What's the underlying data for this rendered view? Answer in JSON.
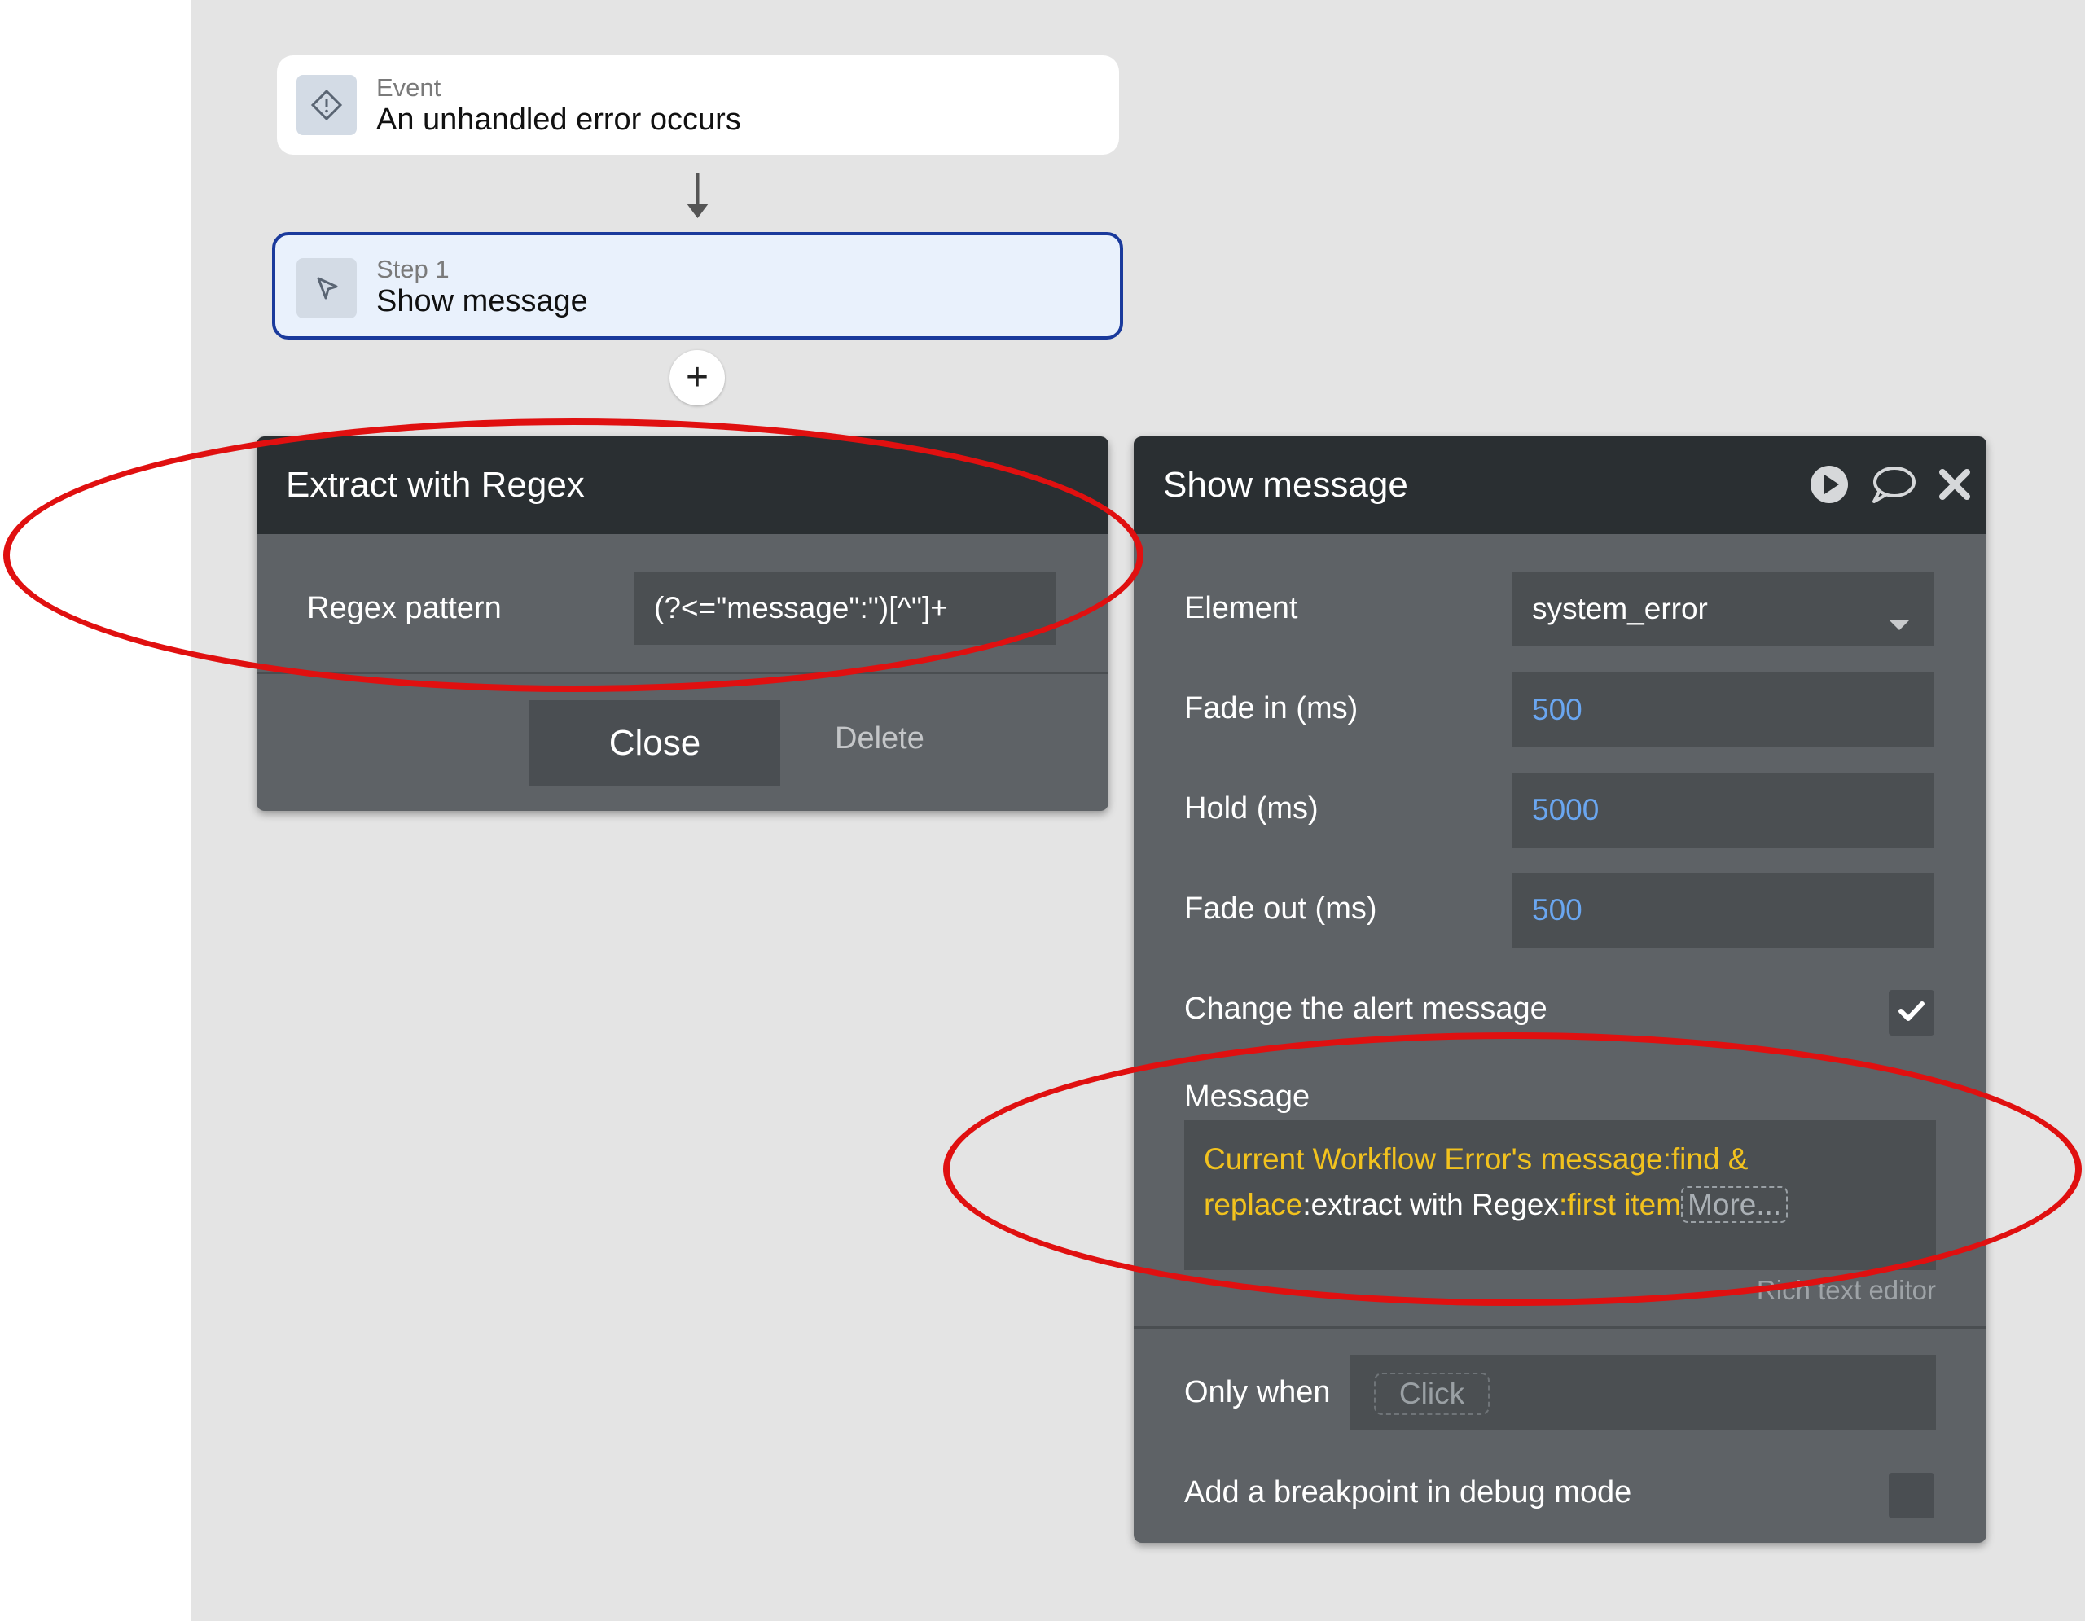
{
  "event": {
    "label": "Event",
    "title": "An unhandled error occurs"
  },
  "step": {
    "label": "Step 1",
    "title": "Show message"
  },
  "add_step": "+",
  "regex_panel": {
    "title": "Extract with Regex",
    "pattern_label": "Regex pattern",
    "pattern_value": "(?<=\"message\":\")[^\"]+",
    "close_label": "Close",
    "delete_label": "Delete"
  },
  "show_message_panel": {
    "title": "Show message",
    "element_label": "Element",
    "element_value": "system_error",
    "fade_in_label": "Fade in (ms)",
    "fade_in_value": "500",
    "hold_label": "Hold (ms)",
    "hold_value": "5000",
    "fade_out_label": "Fade out (ms)",
    "fade_out_value": "500",
    "change_alert_label": "Change the alert message",
    "change_alert_checked": true,
    "message_label": "Message",
    "message_parts": {
      "p1": "Current Workflow Error's message:find &",
      "p2": "replace",
      "p3": ":extract with Regex",
      "p4": ":first item",
      "more": "More..."
    },
    "rich_text_label": "Rich text editor",
    "only_when_label": "Only when",
    "only_when_placeholder": "Click",
    "breakpoint_label": "Add a breakpoint in debug mode",
    "breakpoint_checked": false
  },
  "colors": {
    "accent_selected": "#1a3a9c",
    "dynamic_text": "#f2c21e",
    "number_text": "#6aa6f0",
    "annotation": "#e01010"
  },
  "icons": [
    "diamond-alert-icon",
    "cursor-arrow-icon",
    "play-icon",
    "comment-icon",
    "close-icon",
    "dropdown-caret-icon",
    "checkmark-icon"
  ]
}
